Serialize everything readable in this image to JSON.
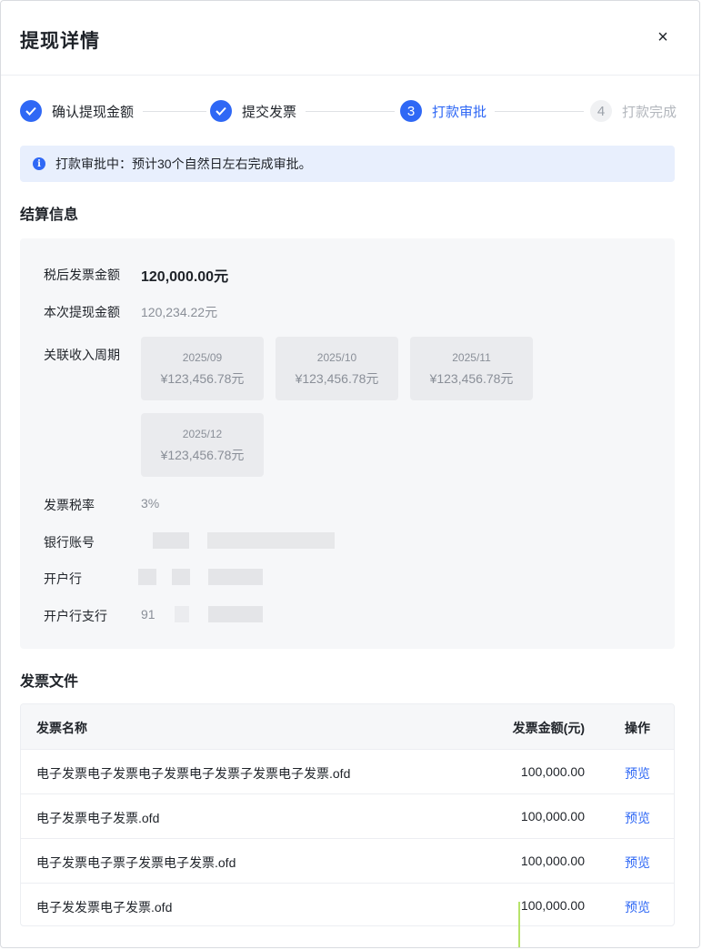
{
  "modal": {
    "title": "提现详情",
    "close_label": "×"
  },
  "steps": [
    {
      "label": "确认提现金额",
      "status": "done",
      "number": "1"
    },
    {
      "label": "提交发票",
      "status": "done",
      "number": "2"
    },
    {
      "label": "打款审批",
      "status": "active",
      "number": "3"
    },
    {
      "label": "打款完成",
      "status": "todo",
      "number": "4"
    }
  ],
  "alert": {
    "text": "打款审批中：预计30个自然日左右完成审批。"
  },
  "settlement": {
    "title": "结算信息",
    "after_tax_invoice_label": "税后发票金额",
    "after_tax_invoice_value": "120,000.00元",
    "withdraw_amount_label": "本次提现金额",
    "withdraw_amount_value": "120,234.22元",
    "income_period_label": "关联收入周期",
    "periods": [
      {
        "month": "2025/09",
        "amount": "¥123,456.78元"
      },
      {
        "month": "2025/10",
        "amount": "¥123,456.78元"
      },
      {
        "month": "2025/11",
        "amount": "¥123,456.78元"
      },
      {
        "month": "2025/12",
        "amount": "¥123,456.78元"
      }
    ],
    "tax_rate_label": "发票税率",
    "tax_rate_value": "3%",
    "bank_account_label": "银行账号",
    "bank_label": "开户行",
    "bank_branch_label": "开户行支行",
    "bank_branch_value_prefix": "91"
  },
  "invoices": {
    "title": "发票文件",
    "columns": {
      "name": "发票名称",
      "amount": "发票金额(元)",
      "action": "操作"
    },
    "rows": [
      {
        "name": "电子发票电子发票电子发票电子发票子发票电子发票.ofd",
        "amount": "100,000.00",
        "action": "预览"
      },
      {
        "name": "电子发票电子发票.ofd",
        "amount": "100,000.00",
        "action": "预览"
      },
      {
        "name": "电子发票电子票子发票电子发票.ofd",
        "amount": "100,000.00",
        "action": "预览"
      },
      {
        "name": "电子发发票电子发票.ofd",
        "amount": "100,000.00",
        "action": "预览"
      }
    ]
  },
  "colors": {
    "accent": "#2f68f5",
    "alert_bg": "#e8effd",
    "panel_bg": "#f6f7f9"
  },
  "icons": {
    "close": "close-icon",
    "check": "check-icon",
    "info": "info-icon"
  }
}
